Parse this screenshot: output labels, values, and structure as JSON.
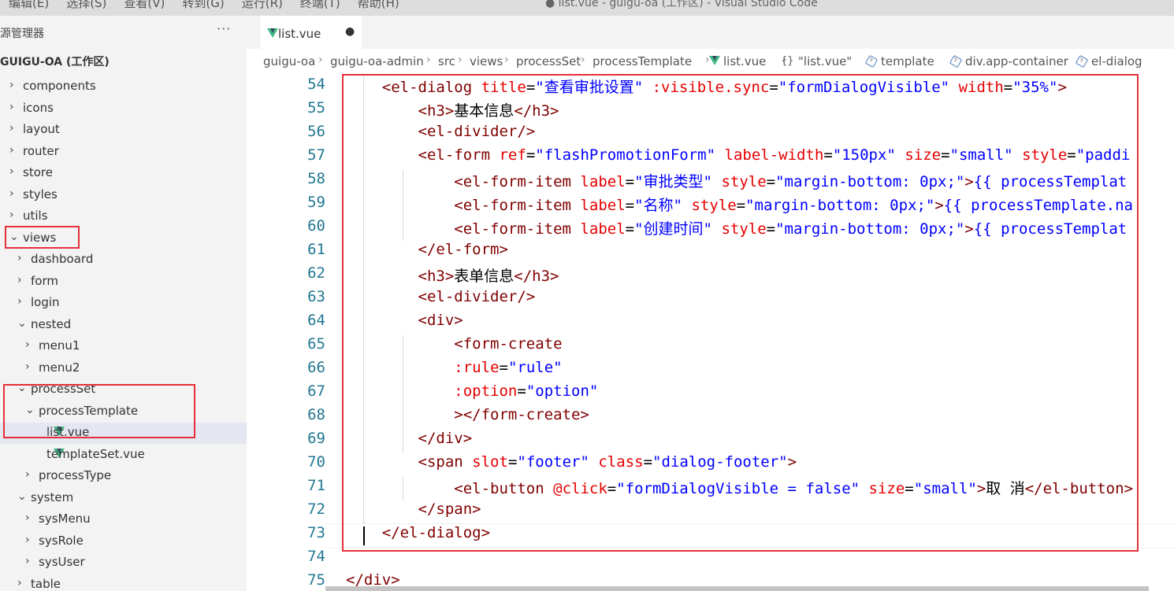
{
  "menu": [
    "编辑(E)",
    "选择(S)",
    "查看(V)",
    "转到(G)",
    "运行(R)",
    "终端(T)",
    "帮助(H)"
  ],
  "window_title": "● list.vue - guigu-oa (工作区) - Visual Studio Code",
  "sidebar": {
    "header": "源管理器",
    "more": "···",
    "workspace": "GUIGU-OA (工作区)",
    "items": [
      {
        "label": "components",
        "chev": "›"
      },
      {
        "label": "icons",
        "chev": "›"
      },
      {
        "label": "layout",
        "chev": "›"
      },
      {
        "label": "router",
        "chev": "›"
      },
      {
        "label": "store",
        "chev": "›"
      },
      {
        "label": "styles",
        "chev": "›"
      },
      {
        "label": "utils",
        "chev": "›"
      },
      {
        "label": "views",
        "chev": "⌄"
      },
      {
        "label": "dashboard",
        "chev": "›"
      },
      {
        "label": "form",
        "chev": "›"
      },
      {
        "label": "login",
        "chev": "›"
      },
      {
        "label": "nested",
        "chev": "⌄"
      },
      {
        "label": "menu1",
        "chev": "›"
      },
      {
        "label": "menu2",
        "chev": "›"
      },
      {
        "label": "processSet",
        "chev": "⌄"
      },
      {
        "label": "processTemplate",
        "chev": "⌄"
      },
      {
        "label": "list.vue",
        "chev": ""
      },
      {
        "label": "templateSet.vue",
        "chev": ""
      },
      {
        "label": "processType",
        "chev": "›"
      },
      {
        "label": "system",
        "chev": "⌄"
      },
      {
        "label": "sysMenu",
        "chev": "›"
      },
      {
        "label": "sysRole",
        "chev": "›"
      },
      {
        "label": "sysUser",
        "chev": "›"
      },
      {
        "label": "table",
        "chev": "›"
      }
    ]
  },
  "tab": {
    "label": "list.vue",
    "dirty": "●"
  },
  "breadcrumb": [
    "guigu-oa",
    "guigu-oa-admin",
    "src",
    "views",
    "processSet",
    "processTemplate",
    "list.vue",
    "\"list.vue\"",
    "template",
    "div.app-container",
    "el-dialog"
  ],
  "breadcrumb_braces": "{}",
  "breadcrumb_sep": "›",
  "editor": {
    "line_numbers": [
      "54",
      "55",
      "56",
      "57",
      "58",
      "59",
      "60",
      "61",
      "62",
      "63",
      "64",
      "65",
      "66",
      "67",
      "68",
      "69",
      "70",
      "71",
      "72",
      "73",
      "74",
      "75"
    ],
    "lines": [
      [
        [
          "    ",
          "txt"
        ],
        [
          "<el-dialog",
          "tag"
        ],
        [
          " ",
          "txt"
        ],
        [
          "title",
          "attr"
        ],
        [
          "=",
          "txt"
        ],
        [
          "\"查看审批设置\"",
          "str"
        ],
        [
          " ",
          "txt"
        ],
        [
          ":visible.sync",
          "attr"
        ],
        [
          "=",
          "txt"
        ],
        [
          "\"formDialogVisible\"",
          "str"
        ],
        [
          " ",
          "txt"
        ],
        [
          "width",
          "attr"
        ],
        [
          "=",
          "txt"
        ],
        [
          "\"35%\"",
          "str"
        ],
        [
          ">",
          "tag"
        ]
      ],
      [
        [
          "        ",
          "txt"
        ],
        [
          "<h3>",
          "tag"
        ],
        [
          "基本信息",
          "txt"
        ],
        [
          "</h3>",
          "tag"
        ]
      ],
      [
        [
          "        ",
          "txt"
        ],
        [
          "<el-divider/>",
          "tag"
        ]
      ],
      [
        [
          "        ",
          "txt"
        ],
        [
          "<el-form",
          "tag"
        ],
        [
          " ",
          "txt"
        ],
        [
          "ref",
          "attr"
        ],
        [
          "=",
          "txt"
        ],
        [
          "\"flashPromotionForm\"",
          "str"
        ],
        [
          " ",
          "txt"
        ],
        [
          "label-width",
          "attr"
        ],
        [
          "=",
          "txt"
        ],
        [
          "\"150px\"",
          "str"
        ],
        [
          " ",
          "txt"
        ],
        [
          "size",
          "attr"
        ],
        [
          "=",
          "txt"
        ],
        [
          "\"small\"",
          "str"
        ],
        [
          " ",
          "txt"
        ],
        [
          "style",
          "attr"
        ],
        [
          "=",
          "txt"
        ],
        [
          "\"paddi",
          "str"
        ]
      ],
      [
        [
          "            ",
          "txt"
        ],
        [
          "<el-form-item",
          "tag"
        ],
        [
          " ",
          "txt"
        ],
        [
          "label",
          "attr"
        ],
        [
          "=",
          "txt"
        ],
        [
          "\"审批类型\"",
          "str"
        ],
        [
          " ",
          "txt"
        ],
        [
          "style",
          "attr"
        ],
        [
          "=",
          "txt"
        ],
        [
          "\"margin-bottom: 0px;\"",
          "str"
        ],
        [
          ">",
          "tag"
        ],
        [
          "{{ processTemplat",
          "str"
        ]
      ],
      [
        [
          "            ",
          "txt"
        ],
        [
          "<el-form-item",
          "tag"
        ],
        [
          " ",
          "txt"
        ],
        [
          "label",
          "attr"
        ],
        [
          "=",
          "txt"
        ],
        [
          "\"名称\"",
          "str"
        ],
        [
          " ",
          "txt"
        ],
        [
          "style",
          "attr"
        ],
        [
          "=",
          "txt"
        ],
        [
          "\"margin-bottom: 0px;\"",
          "str"
        ],
        [
          ">",
          "tag"
        ],
        [
          "{{ processTemplate.na",
          "str"
        ]
      ],
      [
        [
          "            ",
          "txt"
        ],
        [
          "<el-form-item",
          "tag"
        ],
        [
          " ",
          "txt"
        ],
        [
          "label",
          "attr"
        ],
        [
          "=",
          "txt"
        ],
        [
          "\"创建时间\"",
          "str"
        ],
        [
          " ",
          "txt"
        ],
        [
          "style",
          "attr"
        ],
        [
          "=",
          "txt"
        ],
        [
          "\"margin-bottom: 0px;\"",
          "str"
        ],
        [
          ">",
          "tag"
        ],
        [
          "{{ processTemplat",
          "str"
        ]
      ],
      [
        [
          "        ",
          "txt"
        ],
        [
          "</el-form>",
          "tag"
        ]
      ],
      [
        [
          "        ",
          "txt"
        ],
        [
          "<h3>",
          "tag"
        ],
        [
          "表单信息",
          "txt"
        ],
        [
          "</h3>",
          "tag"
        ]
      ],
      [
        [
          "        ",
          "txt"
        ],
        [
          "<el-divider/>",
          "tag"
        ]
      ],
      [
        [
          "        ",
          "txt"
        ],
        [
          "<div>",
          "tag"
        ]
      ],
      [
        [
          "            ",
          "txt"
        ],
        [
          "<form-create",
          "tag"
        ]
      ],
      [
        [
          "            ",
          "txt"
        ],
        [
          ":rule",
          "attr"
        ],
        [
          "=",
          "txt"
        ],
        [
          "\"rule\"",
          "str"
        ]
      ],
      [
        [
          "            ",
          "txt"
        ],
        [
          ":option",
          "attr"
        ],
        [
          "=",
          "txt"
        ],
        [
          "\"option\"",
          "str"
        ]
      ],
      [
        [
          "            ",
          "txt"
        ],
        [
          "></form-create>",
          "tag"
        ]
      ],
      [
        [
          "        ",
          "txt"
        ],
        [
          "</div>",
          "tag"
        ]
      ],
      [
        [
          "        ",
          "txt"
        ],
        [
          "<span",
          "tag"
        ],
        [
          " ",
          "txt"
        ],
        [
          "slot",
          "attr"
        ],
        [
          "=",
          "txt"
        ],
        [
          "\"footer\"",
          "str"
        ],
        [
          " ",
          "txt"
        ],
        [
          "class",
          "attr"
        ],
        [
          "=",
          "txt"
        ],
        [
          "\"dialog-footer\"",
          "str"
        ],
        [
          ">",
          "tag"
        ]
      ],
      [
        [
          "            ",
          "txt"
        ],
        [
          "<el-button",
          "tag"
        ],
        [
          " ",
          "txt"
        ],
        [
          "@click",
          "attr"
        ],
        [
          "=",
          "txt"
        ],
        [
          "\"formDialogVisible = false\"",
          "str"
        ],
        [
          " ",
          "txt"
        ],
        [
          "size",
          "attr"
        ],
        [
          "=",
          "txt"
        ],
        [
          "\"small\"",
          "str"
        ],
        [
          ">",
          "tag"
        ],
        [
          "取 消",
          "txt"
        ],
        [
          "</el-button>",
          "tag"
        ]
      ],
      [
        [
          "        ",
          "txt"
        ],
        [
          "</span>",
          "tag"
        ]
      ],
      [
        [
          "    ",
          "txt"
        ],
        [
          "</el-dialog>",
          "tag"
        ]
      ],
      [
        [
          "",
          "txt"
        ]
      ],
      [
        [
          "",
          "txt"
        ],
        [
          "</div>",
          "tag"
        ]
      ]
    ]
  },
  "colors": {
    "tag": "#800000",
    "attr": "#e50000",
    "string": "#0000ff",
    "line_number": "#237893",
    "annotation": "#e5303a"
  }
}
